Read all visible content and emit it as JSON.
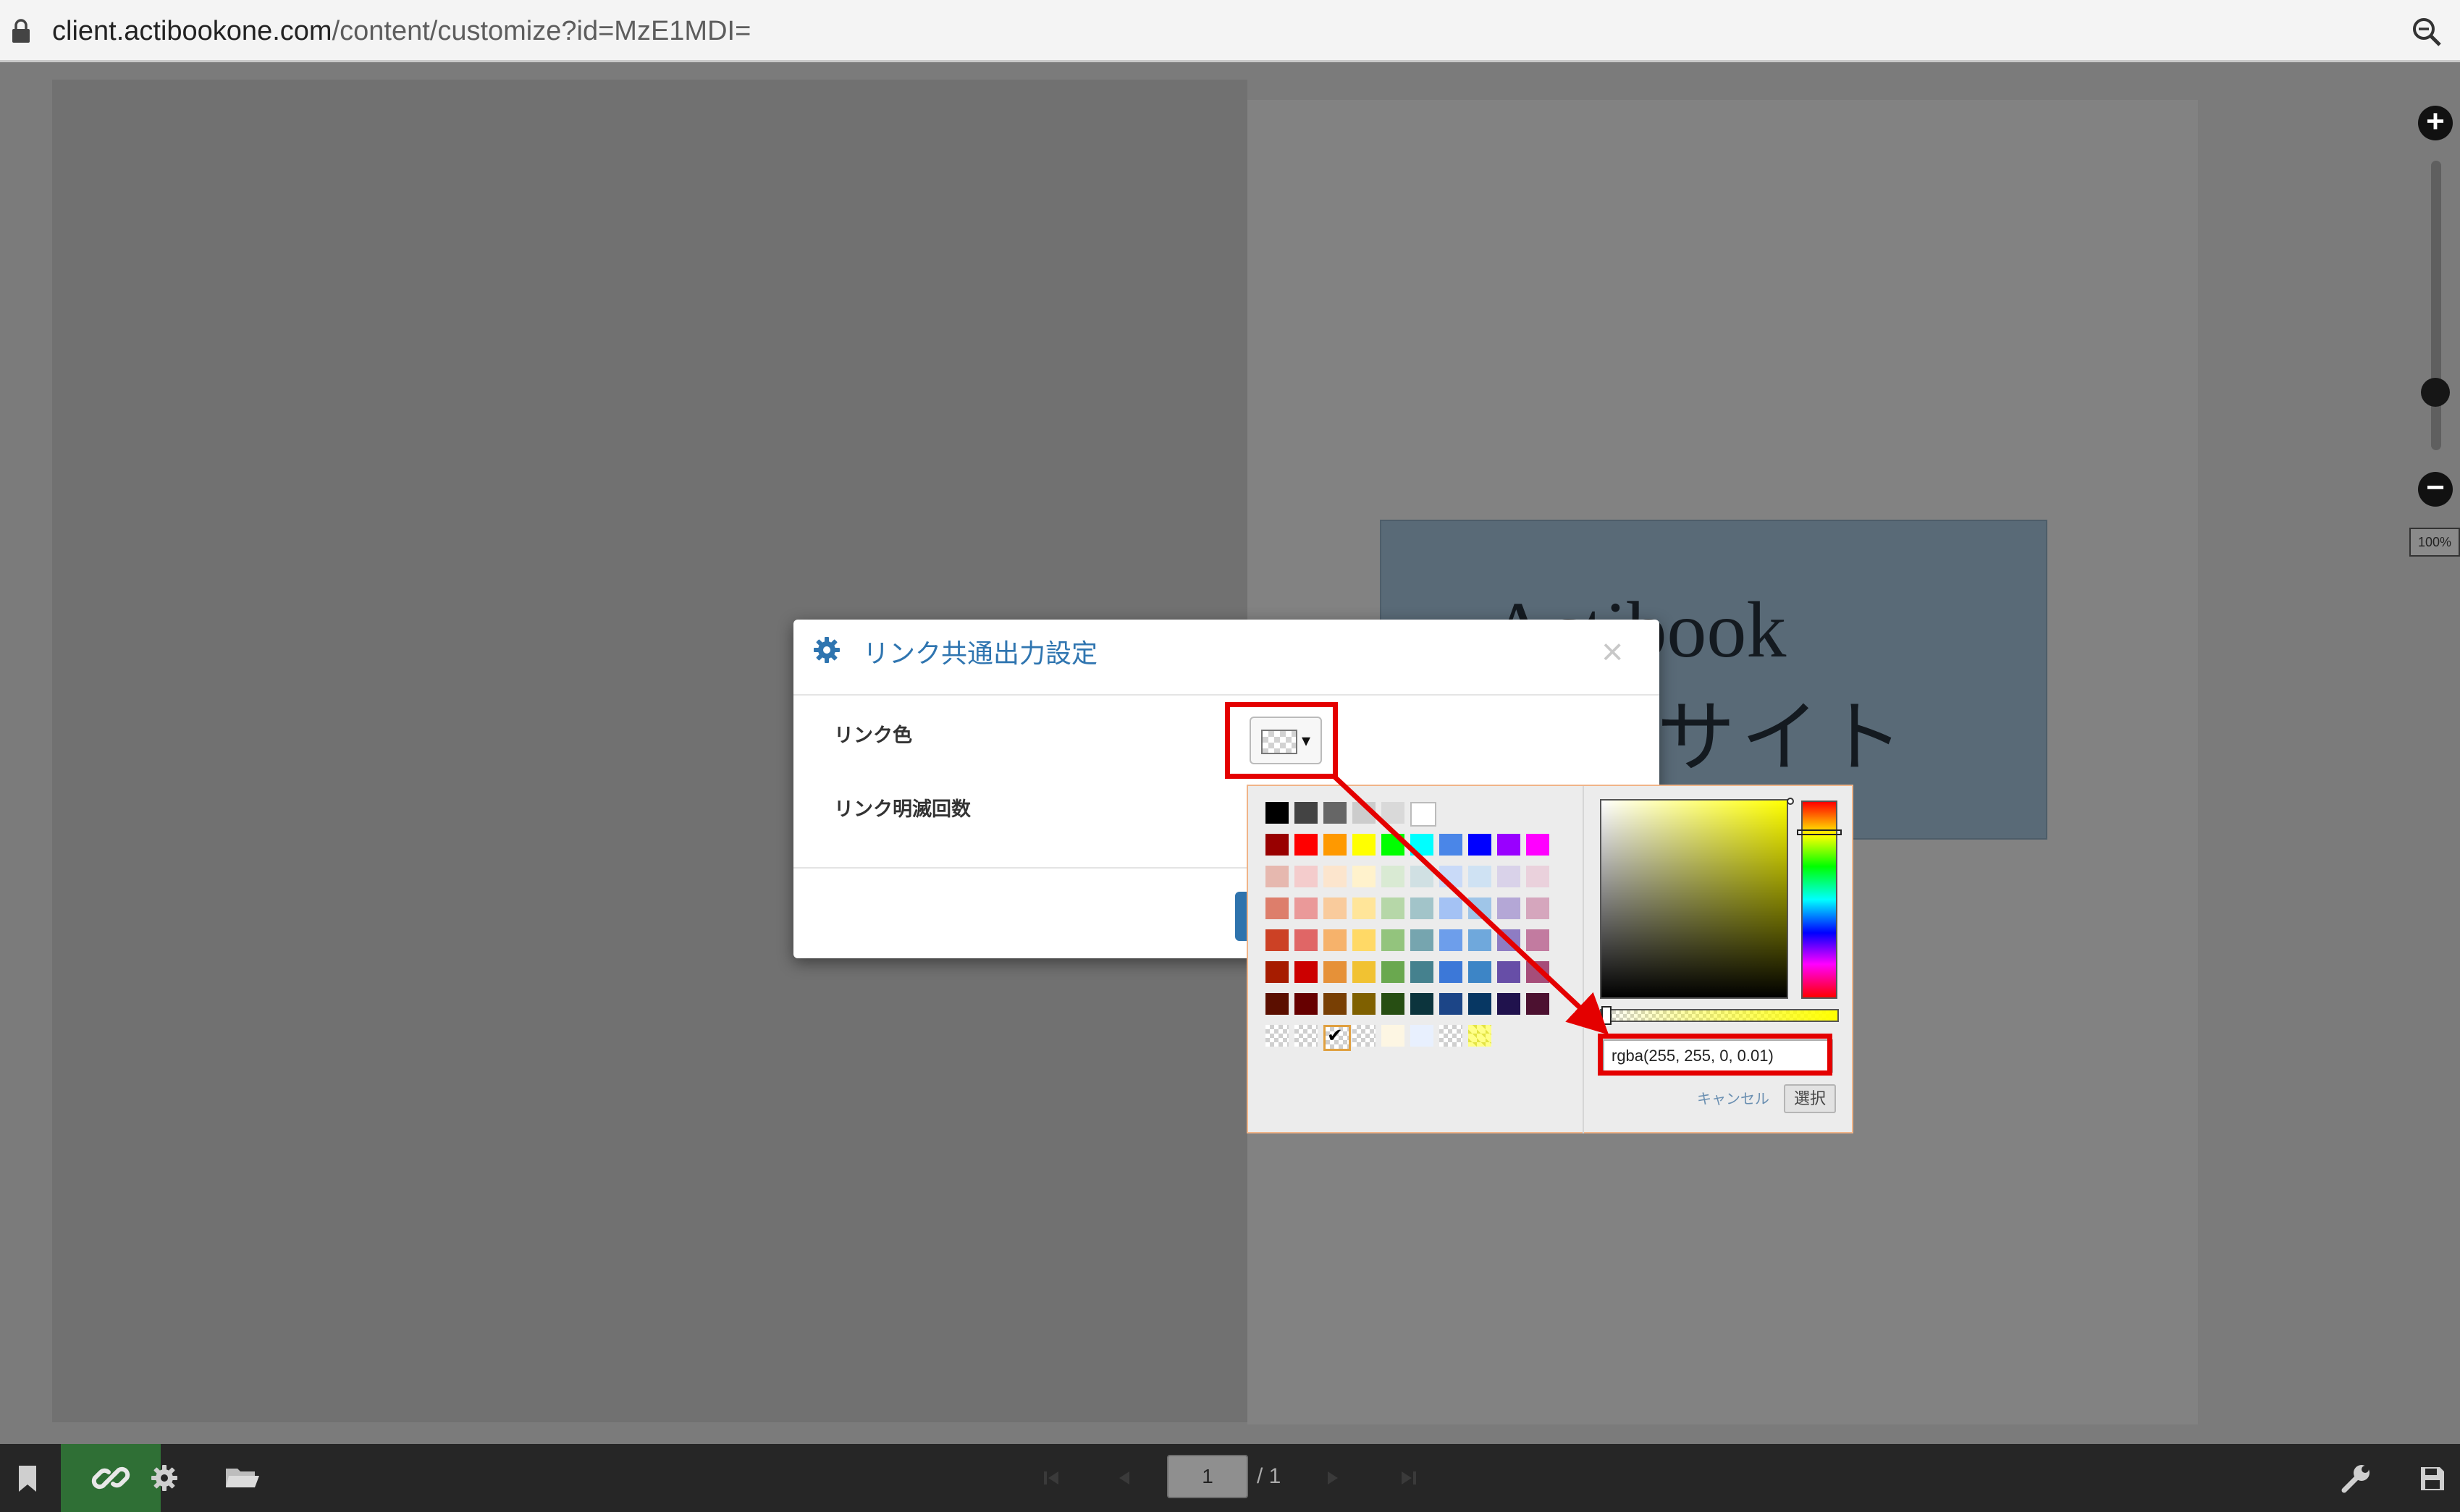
{
  "browser": {
    "url_host": "client.actibookone.com",
    "url_path": "/content/customize?id=MzE1MDI="
  },
  "book": {
    "cover_title": "Actibook",
    "cover_subtitle": "アルサイト"
  },
  "zoom": {
    "percent_label": "100%",
    "level_fraction": 0.2
  },
  "dialog": {
    "title": "リンク共通出力設定",
    "close_glyph": "×",
    "fields": {
      "link_color_label": "リンク色",
      "link_blink_label": "リンク明滅回数"
    }
  },
  "color_trigger": {
    "caret": "▾"
  },
  "color_picker": {
    "palette": [
      [
        "#000000",
        "#434343",
        "#666666",
        "#cccccc",
        "#d9d9d9",
        "#ffffff"
      ],
      [
        "#980000",
        "#ff0000",
        "#ff9900",
        "#ffff00",
        "#00ff00",
        "#00ffff",
        "#4a86e8",
        "#0000ff",
        "#9900ff",
        "#ff00ff"
      ],
      [
        "#e6b8af",
        "#f4cccc",
        "#fce5cd",
        "#fff2cc",
        "#d9ead3",
        "#d0e0e3",
        "#c9daf8",
        "#cfe2f3",
        "#d9d2e9",
        "#ead1dc"
      ],
      [
        "#dd7e6b",
        "#ea9999",
        "#f9cb9c",
        "#ffe599",
        "#b6d7a8",
        "#a2c4c9",
        "#a4c2f4",
        "#9fc5e8",
        "#b4a7d6",
        "#d5a6bd"
      ],
      [
        "#cc4125",
        "#e06666",
        "#f6b26b",
        "#ffd966",
        "#93c47d",
        "#76a5af",
        "#6d9eeb",
        "#6fa8dc",
        "#8e7cc3",
        "#c27ba0"
      ],
      [
        "#a61c00",
        "#cc0000",
        "#e69138",
        "#f1c232",
        "#6aa84f",
        "#45818e",
        "#3c78d8",
        "#3d85c6",
        "#674ea7",
        "#a64d79"
      ],
      [
        "#5b0f00",
        "#660000",
        "#783f04",
        "#7f6000",
        "#274e13",
        "#0c343d",
        "#1c4587",
        "#073763",
        "#20124d",
        "#4c1130"
      ]
    ],
    "recent": [
      "checker",
      "checker",
      "selected-checker",
      "checker",
      "#fdf6e3",
      "#e8f0fe",
      "checker",
      "#ffff88"
    ],
    "selected_mark": "✔",
    "rgba_value": "rgba(255, 255, 0, 0.01)",
    "cancel_label": "キャンセル",
    "choose_label": "選択",
    "current_color": "#ffff00"
  },
  "pager": {
    "current_page": "1",
    "total_label": "/ 1"
  },
  "toolbar": {
    "icons": [
      "bookmark-icon",
      "link-icon",
      "gear-icon",
      "folder-icon",
      "wrench-icon",
      "save-icon"
    ],
    "active_icon": "link-icon"
  },
  "annotation": {
    "color": "#e40000"
  }
}
